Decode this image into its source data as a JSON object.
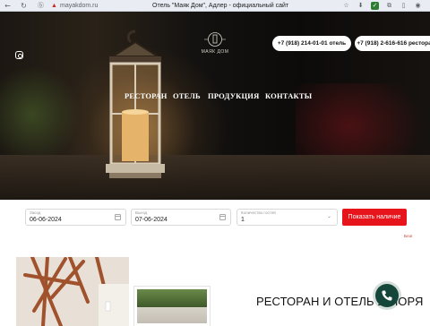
{
  "browser": {
    "url": "mayakdom.ru",
    "tab_title": "Отель \"Маяк Дом\", Адлер - официальный сайт"
  },
  "hero": {
    "logo_text": "МАЯК ДОМ",
    "phones": [
      "+7 (918) 214-01-01 отель",
      "+7 (918) 2-616-616 ресторан"
    ],
    "menu": [
      "РЕСТОРАН",
      "ОТЕЛЬ",
      "ПРОДУКЦИЯ",
      "КОНТАКТЫ"
    ]
  },
  "booking": {
    "checkin_label": "Заезд",
    "checkin_value": "06-06-2024",
    "checkout_label": "Выезд",
    "checkout_value": "07-06-2024",
    "guests_label": "Количество гостей",
    "guests_value": "1",
    "submit_label": "Показать наличие",
    "small_link": "Блог"
  },
  "content": {
    "section_title": "РЕСТОРАН И ОТЕЛЬ У МОРЯ"
  },
  "colors": {
    "accent_red": "#e8141b",
    "call_green": "#14473a"
  }
}
